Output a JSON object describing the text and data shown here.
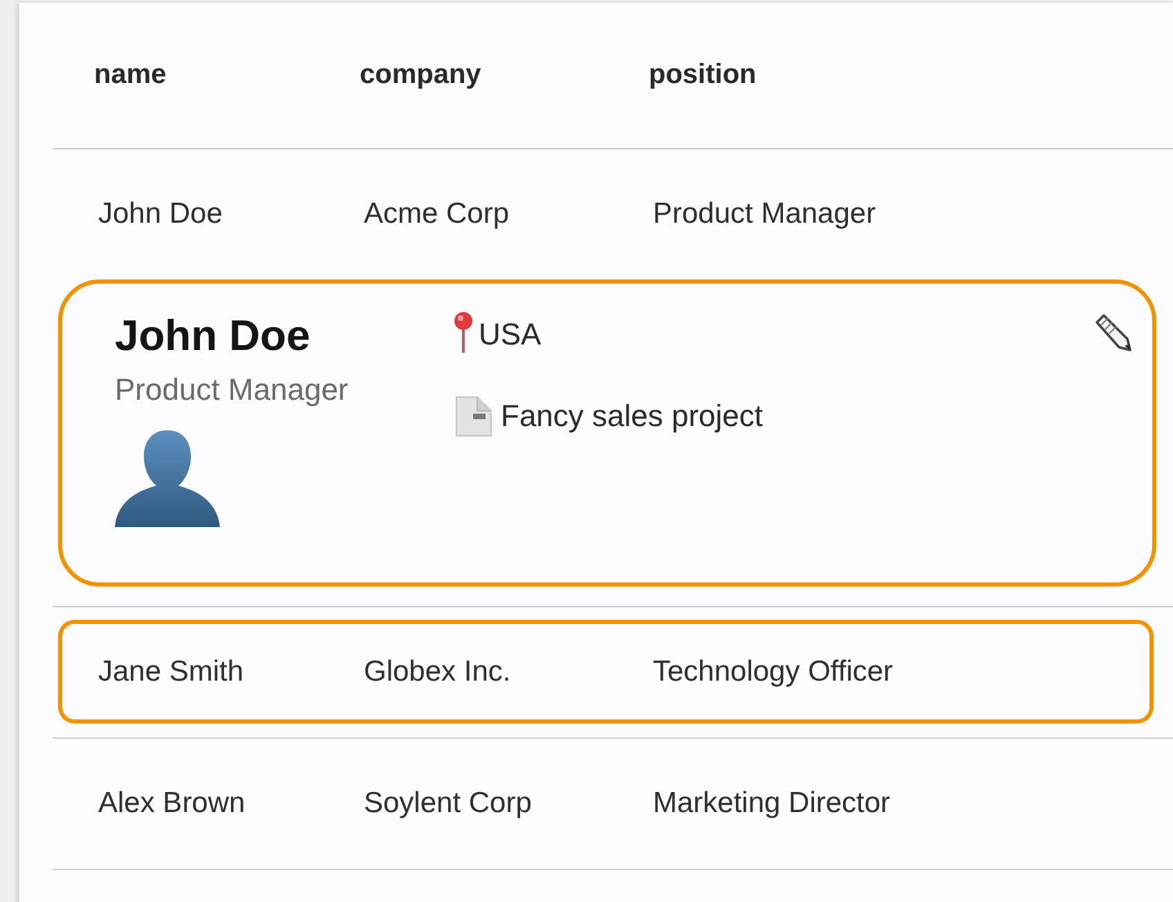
{
  "table": {
    "columns": [
      "name",
      "company",
      "position"
    ],
    "rows": [
      {
        "name": "John Doe",
        "company": "Acme Corp",
        "position": "Product Manager",
        "selected": false,
        "detail": {
          "name": "John Doe",
          "position": "Product Manager",
          "location": "USA",
          "project": "Fancy sales project"
        }
      },
      {
        "name": "Jane Smith",
        "company": "Globex Inc.",
        "position": "Technology Officer",
        "selected": true
      },
      {
        "name": "Alex Brown",
        "company": "Soylent Corp",
        "position": "Marketing Director",
        "selected": false
      }
    ]
  }
}
